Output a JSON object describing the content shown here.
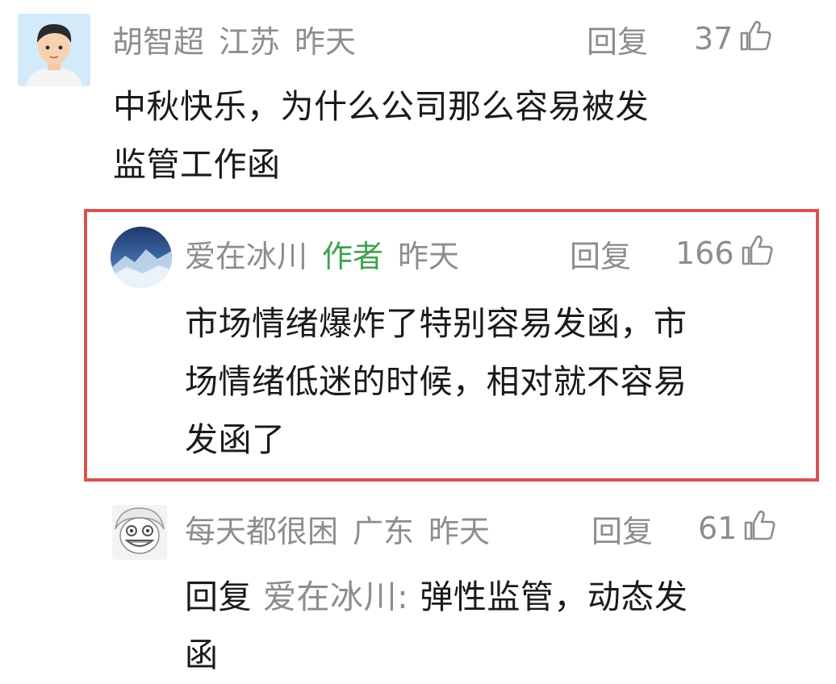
{
  "comments": [
    {
      "username": "胡智超",
      "location": "江苏",
      "time": "昨天",
      "reply_label": "回复",
      "likes": "37",
      "text_line1": "中秋快乐，为什么公司那么容易被发",
      "text_line2": "监管工作函"
    },
    {
      "username": "爱在冰川",
      "author_badge": "作者",
      "time": "昨天",
      "reply_label": "回复",
      "likes": "166",
      "text_line1": "市场情绪爆炸了特别容易发函，市",
      "text_line2": "场情绪低迷的时候，相对就不容易",
      "text_line3": "发函了",
      "highlight_color": "#d9534f"
    },
    {
      "username": "每天都很困",
      "location": "广东",
      "time": "昨天",
      "reply_label": "回复",
      "likes": "61",
      "reply_prefix": "回复",
      "reply_to": "爱在冰川:",
      "text_line1": "弹性监管，动态发",
      "text_line2": "函"
    }
  ],
  "colors": {
    "meta_gray": "#8d8d8d",
    "author_green": "#3fa34d",
    "text_dark": "#1a1a1a",
    "highlight_red": "#d9534f"
  },
  "icons": {
    "like": "thumbs-up-icon"
  }
}
